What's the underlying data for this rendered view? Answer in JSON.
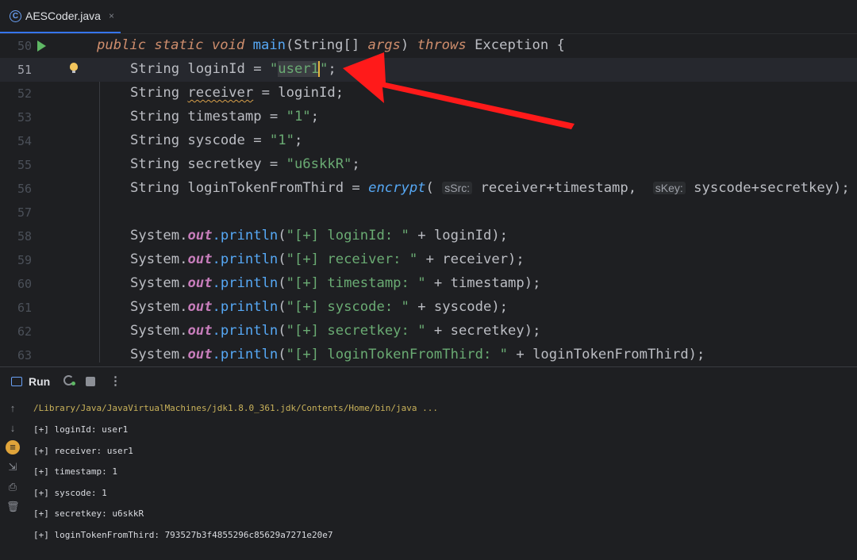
{
  "tab": {
    "file_name": "AESCoder.java",
    "file_icon": "C",
    "close": "×"
  },
  "editor": {
    "line_numbers": [
      "50",
      "51",
      "52",
      "53",
      "54",
      "55",
      "56",
      "57",
      "58",
      "59",
      "60",
      "61",
      "62",
      "63"
    ],
    "l50": {
      "kw1": "public static void",
      "fn": "main",
      "p1": "(String[] ",
      "arg": "args",
      "p2": ") ",
      "kw2": "throws",
      "p3": " Exception {"
    },
    "l51": {
      "a": "String loginId = ",
      "q1": "\"",
      "sel": "user1",
      "q2": "\"",
      "b": ";"
    },
    "l52": {
      "a": "String ",
      "warn": "receiver",
      "b": " = loginId;"
    },
    "l53": {
      "a": "String timestamp = ",
      "s": "\"1\"",
      "b": ";"
    },
    "l54": {
      "a": "String syscode = ",
      "s": "\"1\"",
      "b": ";"
    },
    "l55": {
      "a": "String secretkey = ",
      "s": "\"u6skkR\"",
      "b": ";"
    },
    "l56": {
      "a": "String loginTokenFromThird = ",
      "fn": "encrypt",
      "p": "( ",
      "h1": "sSrc:",
      "v1": " receiver+timestamp,  ",
      "h2": "sKey:",
      "v2": " syscode+secretkey);"
    },
    "println": [
      {
        "s": "\"[+] loginId: \"",
        "b": " + loginId);"
      },
      {
        "s": "\"[+] receiver: \"",
        "b": " + receiver);"
      },
      {
        "s": "\"[+] timestamp: \"",
        "b": " + timestamp);"
      },
      {
        "s": "\"[+] syscode: \"",
        "b": " + syscode);"
      },
      {
        "s": "\"[+] secretkey: \"",
        "b": " + secretkey);"
      },
      {
        "s": "\"[+] loginTokenFromThird: \"",
        "b": " + loginTokenFromThird);"
      }
    ],
    "sys": "System.",
    "out": "out",
    "dot_println": ".println",
    "paren": "("
  },
  "run_panel": {
    "title": "Run",
    "more": "⋮",
    "path": "/Library/Java/JavaVirtualMachines/jdk1.8.0_361.jdk/Contents/Home/bin/java ...",
    "output": [
      "[+] loginId: user1",
      "[+] receiver: user1",
      "[+] timestamp: 1",
      "[+] syscode: 1",
      "[+] secretkey: u6skkR",
      "[+] loginTokenFromThird: 793527b3f4855296c85629a7271e20e7"
    ],
    "tools": [
      "↑",
      "↓",
      "≡",
      "⇲",
      "⎙",
      "🗑"
    ]
  },
  "colors": {
    "arrow": "#ff1a1a",
    "accent": "#3574f0",
    "run": "#5fb865"
  }
}
